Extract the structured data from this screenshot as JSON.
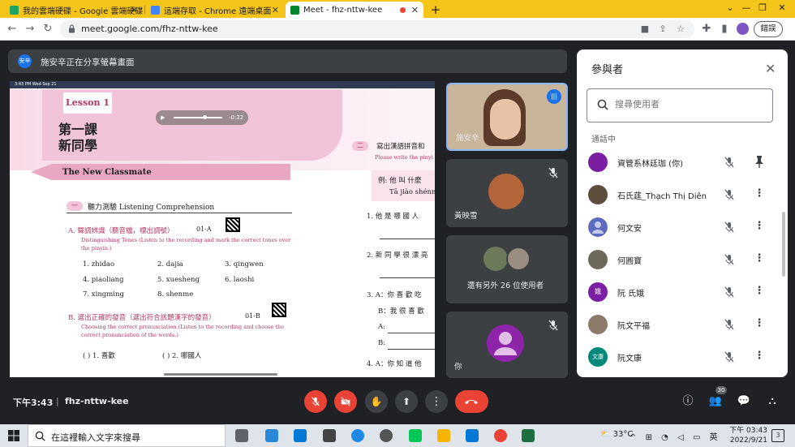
{
  "browser": {
    "tabs": [
      {
        "title": "我的雲端硬碟 - Google 雲端硬碟",
        "favicon_color": "#1fa463"
      },
      {
        "title": "這端存取 - Chrome 遠端桌面",
        "favicon_color": "#4285f4"
      },
      {
        "title": "Meet - fhz-nttw-kee",
        "favicon_color": "#00832d",
        "active": true
      }
    ],
    "url": "meet.google.com/fhz-nttw-kee",
    "update_label": "錯誤"
  },
  "share_banner": {
    "avatar_text": "安辛",
    "text": "施安辛正在分享螢幕畫面"
  },
  "slide": {
    "tablet_status": "3:43 PM  Wed Sep 21",
    "lesson_label": "Lesson 1",
    "title_line1": "第一課",
    "title_line2": "新同學",
    "audio_time": "-0:22",
    "subtitle": "The New Classmate",
    "section1_num": "一",
    "section1_title": "聽力測驗 Listening Comprehension",
    "partA_title": "A.  聲調辨識（聽音檔，標出調號）",
    "partA_code": "01-A",
    "partA_en1": "Distinguishing Tones (Listen to the recording and mark the correct tones over",
    "partA_en2": "the pinyin.)",
    "words": [
      "1. zhidao",
      "2. dajia",
      "3. qingwen",
      "4. piaoliang",
      "5. xuesheng",
      "6. laoshi",
      "7. xingming",
      "8. shenme"
    ],
    "partB_title": "B.  選出正確的發音（選出符合該題漢字的發音）",
    "partB_code": "01-B",
    "partB_en1": "Choosing the correct pronunciation (Listen to the recording and choose the",
    "partB_en2": "correct pronunciation of the words.)",
    "partB_items": [
      "(    ) 1. 喜歡",
      "(    ) 2. 哪國人"
    ],
    "section2_num": "二",
    "section2_title": "寫出漢語拼音和",
    "section2_en": "Please write the pinyi",
    "example_zh": "例: 他  叫  什麼",
    "example_py": "Tā jiào shénm",
    "q1": "1. 他  是  哪  國  人",
    "q2": "2. 新  同 學  很  漂 亮",
    "q3": "3. A：你  喜 歡  吃",
    "q3b": "B：我  很  喜 歡",
    "q3c": "A:",
    "q3d": "B:",
    "q4": "4. A：你  知 道  他"
  },
  "tiles": [
    {
      "name": "施安辛",
      "speaking": true
    },
    {
      "name": "黃映雪"
    },
    {
      "name": "還有另外 26 位使用者"
    },
    {
      "name": "你"
    }
  ],
  "panel": {
    "title": "參與者",
    "search_placeholder": "搜尋使用者",
    "section_label": "通話中",
    "participants": [
      {
        "name": "資管系林廷珈 (你)",
        "avatar_color": "#7b1fa2",
        "avatar_text": ""
      },
      {
        "name": "石氏莛_Thạch Thị Diên",
        "avatar_color": "#5d4e3c",
        "avatar_text": ""
      },
      {
        "name": "何文安",
        "avatar_color": "#5c6bc0",
        "avatar_text": ""
      },
      {
        "name": "何圓寶",
        "avatar_color": "#6d6a5a",
        "avatar_text": ""
      },
      {
        "name": "阮 氏娥",
        "avatar_color": "#7b1fa2",
        "avatar_text": "娥"
      },
      {
        "name": "阮文平福",
        "avatar_color": "#8d7b6a",
        "avatar_text": ""
      },
      {
        "name": "阮文康",
        "avatar_color": "#00897b",
        "avatar_text": "文康"
      }
    ]
  },
  "bottom": {
    "time": "下午3:43",
    "separator": "|",
    "meeting_code": "fhz-nttw-kee",
    "people_count": "30"
  },
  "taskbar": {
    "search_placeholder": "在這裡輸入文字來搜尋",
    "temperature": "33°C",
    "ime": "英",
    "time": "下午 03:43",
    "date": "2022/9/21",
    "notification_count": "3"
  }
}
